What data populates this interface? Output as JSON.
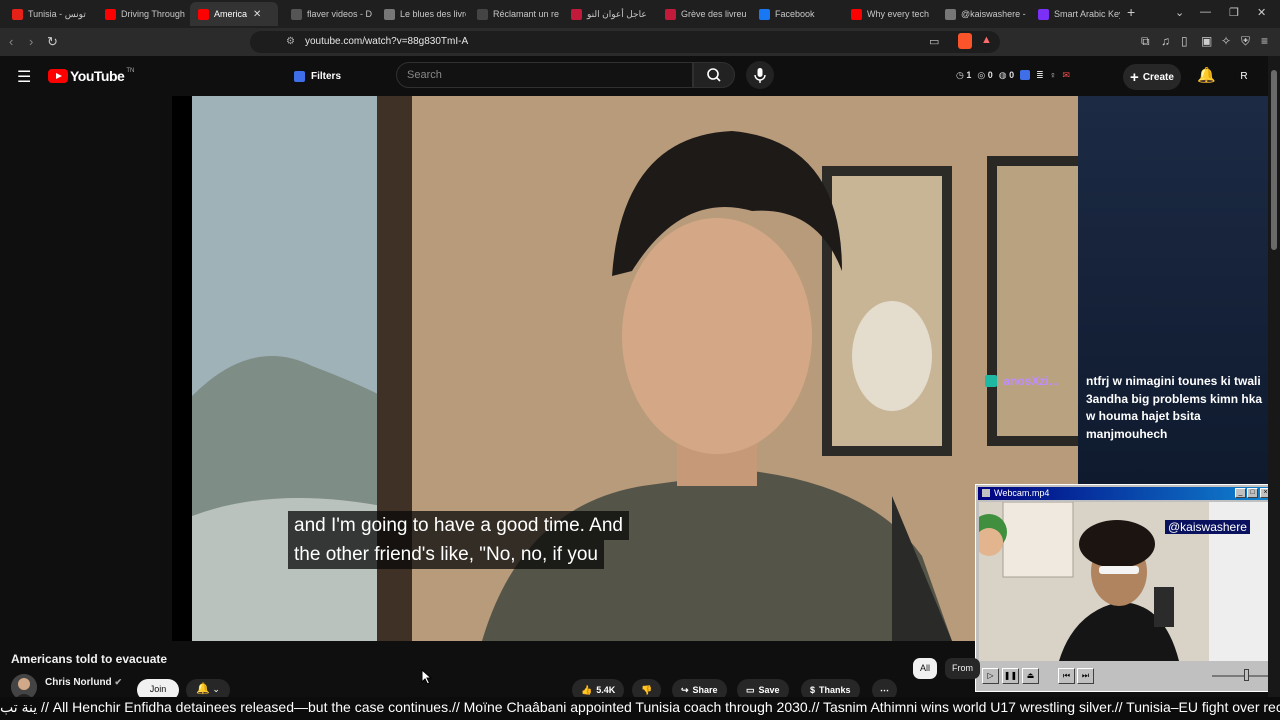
{
  "browser": {
    "tabs": [
      {
        "title": "Tunisia - تونس",
        "fav_color": "#e62117"
      },
      {
        "title": "Driving Through",
        "fav_color": "#ff0000"
      },
      {
        "title": "America",
        "fav_color": "#ff0000",
        "active": true
      },
      {
        "title": "flaver videos - D",
        "fav_color": "#555555"
      },
      {
        "title": "Le blues des livre",
        "fav_color": "#777777"
      },
      {
        "title": "Réclamant un re",
        "fav_color": "#444444"
      },
      {
        "title": "عاجل أعوان النو",
        "fav_color": "#c21a3a"
      },
      {
        "title": "Grève des livreu",
        "fav_color": "#c21a3a"
      },
      {
        "title": "Facebook",
        "fav_color": "#1877f2"
      },
      {
        "title": "Why every tech",
        "fav_color": "#ff0000"
      },
      {
        "title": "@kaiswashere -",
        "fav_color": "#777777"
      },
      {
        "title": "Smart Arabic Key",
        "fav_color": "#7b2ff7"
      }
    ],
    "url": "youtube.com/watch?v=88g830TmI-A"
  },
  "youtube": {
    "logo_text": "YouTube",
    "logo_sup": "TN",
    "filters_label": "Filters",
    "search_placeholder": "Search",
    "counters": [
      "1",
      "0",
      "0"
    ],
    "create_label": "Create",
    "avatar_letter": "R"
  },
  "video": {
    "captions": [
      "and I'm going to have a good time. And",
      "the other friend's like, \"No, no, if you"
    ],
    "title": "Americans told to evacuate",
    "channel": "Chris Norlund",
    "join_label": "Join",
    "likes": "5.4K",
    "share_label": "Share",
    "save_label": "Save",
    "thanks_label": "Thanks",
    "chips": [
      "All",
      "From"
    ]
  },
  "chat": {
    "user": "anosXzi...",
    "message": "ntfrj w nimagini tounes ki twali 3andha big problems kimn hka w houma hajet bsita manjmouhech"
  },
  "webcam": {
    "title": "Webcam.mp4",
    "tag": "@kaiswashere"
  },
  "ticker": {
    "text": "ينة تب // All Henchir Enfidha detainees released—but the case continues.// Moïne Chaâbani appointed Tunisia coach through 2030.// Tasnim Athimni wins world U17 wrestling silver.// Tunisia–EU fight over rec"
  },
  "colors": {
    "brand_red": "#ff0000",
    "chat_name": "#c18cff",
    "win_title": "#000080"
  }
}
